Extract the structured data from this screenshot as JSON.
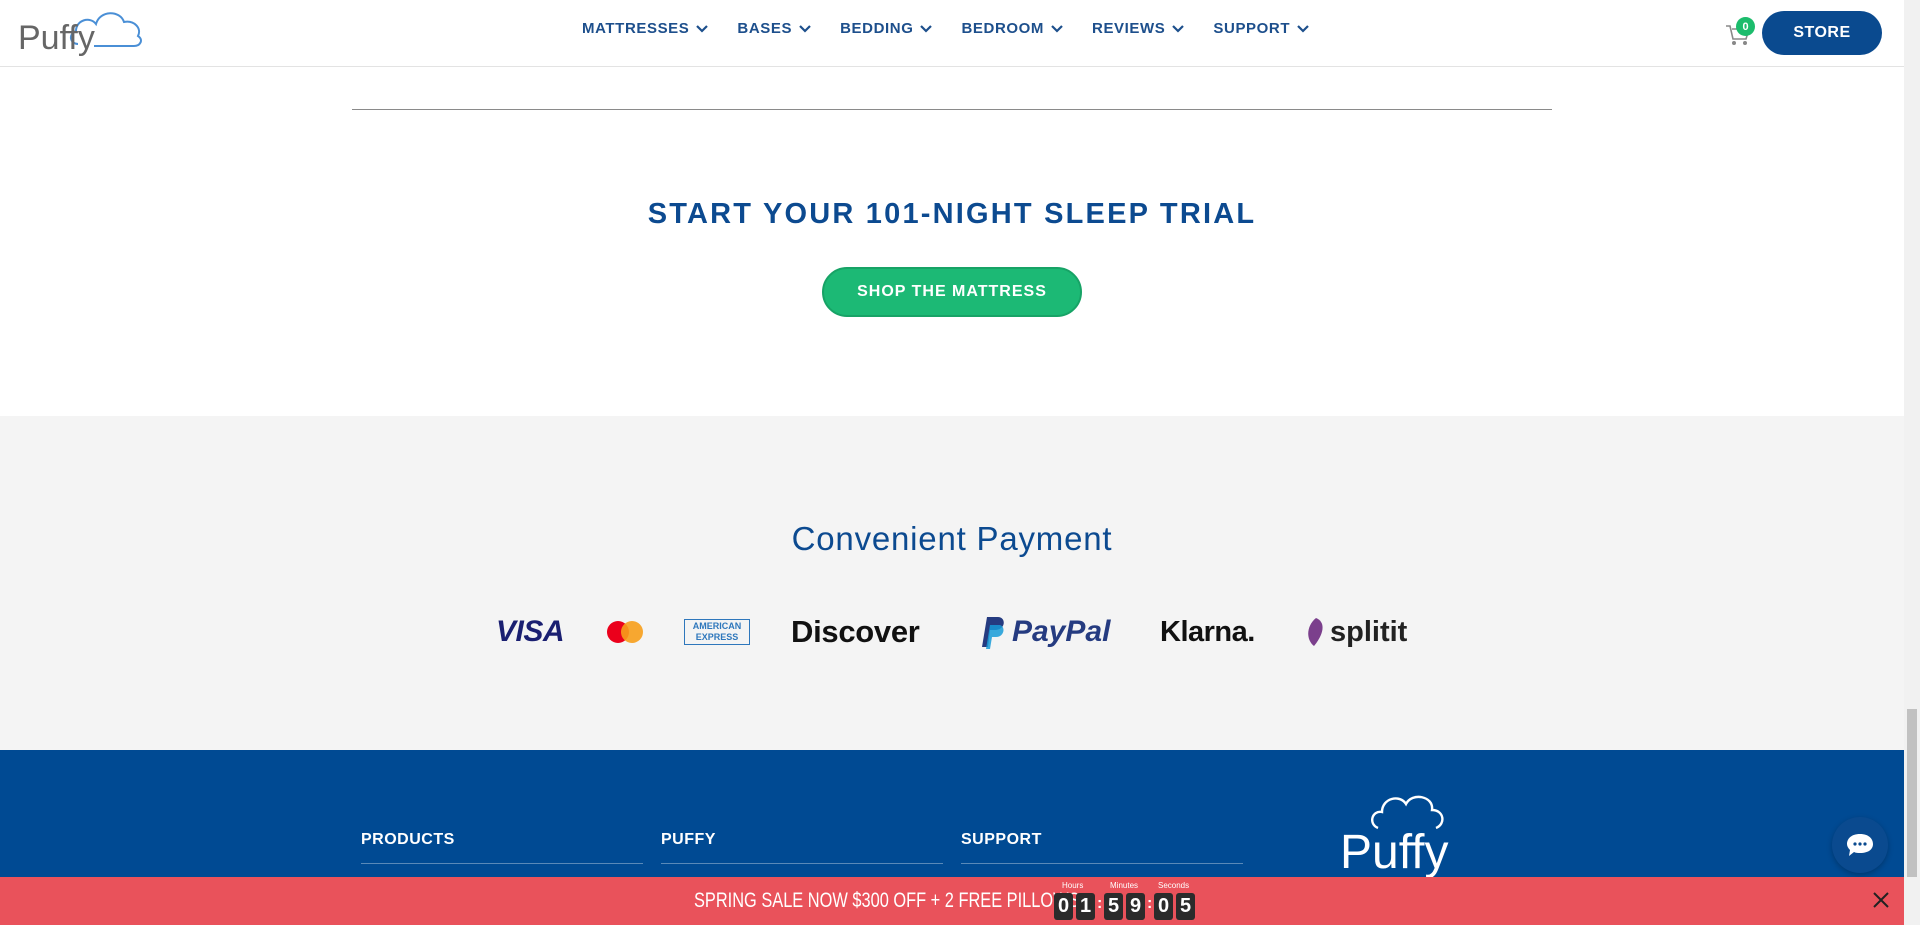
{
  "header": {
    "logo_text": "Puffy",
    "nav": [
      {
        "label": "MATTRESSES"
      },
      {
        "label": "BASES"
      },
      {
        "label": "BEDDING"
      },
      {
        "label": "BEDROOM"
      },
      {
        "label": "REVIEWS"
      },
      {
        "label": "SUPPORT"
      }
    ],
    "cart_count": "0",
    "store_label": "STORE"
  },
  "trial": {
    "title": "START YOUR 101-NIGHT SLEEP TRIAL",
    "button_label": "SHOP THE MATTRESS"
  },
  "payment": {
    "title": "Convenient Payment",
    "methods": [
      "VISA",
      "Mastercard",
      "AMERICAN EXPRESS",
      "Discover",
      "PayPal",
      "Klarna.",
      "splitit"
    ]
  },
  "footer": {
    "columns": [
      {
        "label": "PRODUCTS"
      },
      {
        "label": "PUFFY"
      },
      {
        "label": "SUPPORT"
      }
    ],
    "logo_text": "Puffy"
  },
  "promo": {
    "text": "SPRING SALE NOW $300 OFF + 2 FREE PILLOWS",
    "labels": {
      "hours": "Hours",
      "minutes": "Minutes",
      "seconds": "Seconds"
    },
    "digits": [
      "0",
      "1",
      "5",
      "9",
      "0",
      "5"
    ]
  },
  "colors": {
    "brand_blue": "#0c4a90",
    "green": "#1cb975",
    "promo_red": "#e9525b",
    "footer_blue": "#004a93"
  }
}
